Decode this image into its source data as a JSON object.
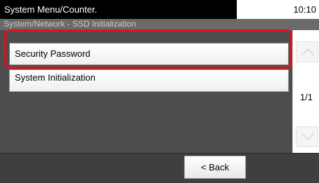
{
  "header": {
    "title": "System Menu/Counter.",
    "time": "10:10"
  },
  "subtitle": "System/Network - SSD Initialization",
  "list": {
    "items": [
      {
        "label": "Security Password"
      },
      {
        "label": "System Initialization"
      }
    ]
  },
  "scroll": {
    "page_indicator": "1/1",
    "up_icon": "chevron-up-icon",
    "down_icon": "chevron-down-icon"
  },
  "footer": {
    "back_label": "< Back"
  },
  "colors": {
    "highlight": "#e2101e",
    "screen_bg": "#4d4d4d",
    "title_bg": "#000000"
  }
}
